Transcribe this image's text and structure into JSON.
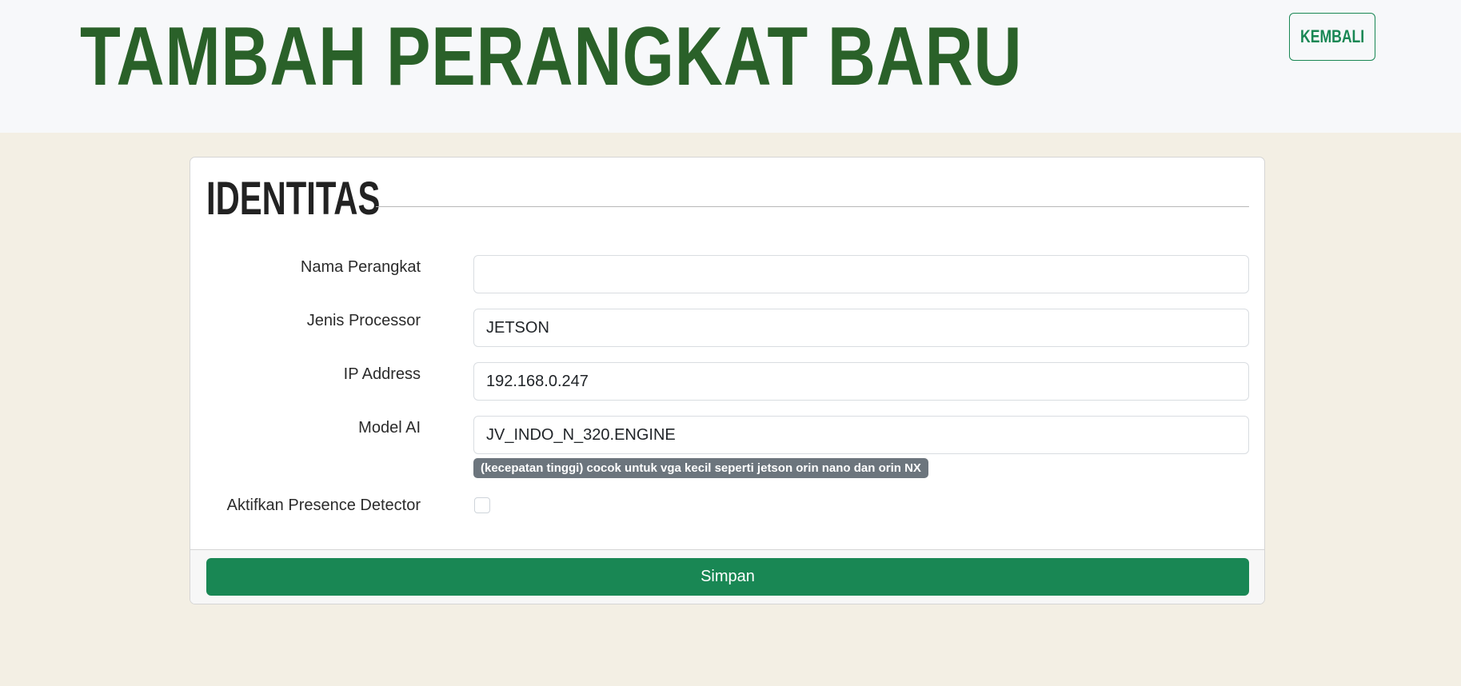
{
  "header": {
    "title": "TAMBAH PERANGKAT BARU",
    "back_label": "KEMBALI"
  },
  "form": {
    "section_title": "IDENTITAS",
    "fields": [
      {
        "label": "Nama Perangkat",
        "value": ""
      },
      {
        "label": "Jenis Processor",
        "value": "JETSON"
      },
      {
        "label": "IP Address",
        "value": "192.168.0.247"
      },
      {
        "label": "Model AI",
        "value": "JV_INDO_N_320.ENGINE"
      }
    ],
    "model_hint": "(kecepatan tinggi) cocok untuk vga kecil seperti jetson orin nano dan orin NX",
    "presence_label": "Aktifkan Presence Detector",
    "presence_checked": false,
    "submit_label": "Simpan"
  },
  "colors": {
    "title_green": "#2a6129",
    "accent_green": "#198754",
    "page_bg": "#f3efe4",
    "header_bg": "#f7f8fa",
    "badge_gray": "#6c757d"
  }
}
